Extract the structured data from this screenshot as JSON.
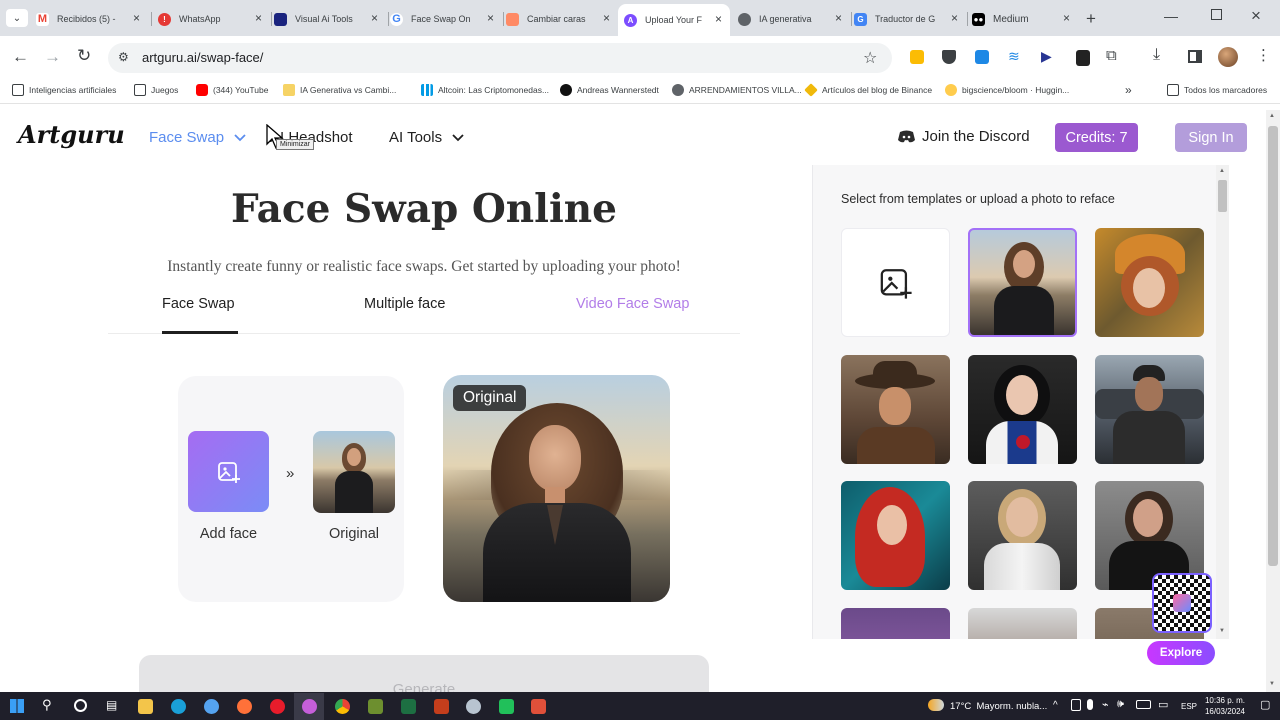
{
  "browser": {
    "tabs": [
      {
        "label": "Recibidos (5) -",
        "icon": "gmail-icon",
        "color": "#ea4335"
      },
      {
        "label": "WhatsApp",
        "icon": "whatsapp-icon",
        "color": "#e53935"
      },
      {
        "label": "Visual Ai Tools",
        "icon": "visualai-icon",
        "color": "#1a237e"
      },
      {
        "label": "Face Swap Onl",
        "icon": "google-icon",
        "color": "#4285f4"
      },
      {
        "label": "Cambiar caras",
        "icon": "cambiar-icon",
        "color": "#ff8a65"
      },
      {
        "label": "Upload Your F",
        "icon": "artguru-icon",
        "color": "#7c4dff"
      },
      {
        "label": "IA generativa",
        "icon": "globe-icon",
        "color": "#5f6368"
      },
      {
        "label": "Traductor de G",
        "icon": "translate-icon",
        "color": "#4285f4"
      },
      {
        "label": "Medium",
        "icon": "medium-icon",
        "color": "#000000"
      }
    ],
    "url": "artguru.ai/swap-face/",
    "bookmarks": [
      "Inteligencias artificiales",
      "Juegos",
      "(344) YouTube",
      "IA Generativa vs Cambi...",
      "Altcoin: Las Criptomonedas...",
      "Andreas Wannerstedt",
      "ARRENDAMIENTOS VILLA...",
      "Artículos del blog de Binance",
      "bigscience/bloom · Huggin..."
    ],
    "all_bookmarks": "Todos los marcadores"
  },
  "site": {
    "logo": "Artguru",
    "nav": {
      "face_swap": "Face Swap",
      "headshot": "AI Headshot",
      "ai_tools": "AI Tools",
      "discord": "Join the Discord",
      "credits": "Credits: 7",
      "sign_in": "Sign In"
    },
    "tooltip": "Minimizar",
    "hero": {
      "title": "Face Swap Online",
      "subtitle": "Instantly create funny or realistic face swaps. Get started by uploading your photo!"
    },
    "mode_tabs": {
      "face_swap": "Face Swap",
      "multiple_face": "Multiple face",
      "video": "Video Face Swap"
    },
    "work": {
      "add_face": "Add face",
      "original": "Original",
      "badge": "Original",
      "generate": "Generate"
    },
    "panel": {
      "heading": "Select from templates or upload a photo to reface",
      "explore": "Explore"
    }
  },
  "taskbar": {
    "weather": "17°C  Mayorm. nubla...",
    "lang": "ESP",
    "time": "10:36 p. m.",
    "date": "16/03/2024"
  },
  "colors": {
    "accent_purple": "#8b5cf6",
    "credits_bg": "#9b59d0",
    "signin_bg": "#b39ddb",
    "link_blue": "#5b8def",
    "video_tab": "#b27de8"
  }
}
